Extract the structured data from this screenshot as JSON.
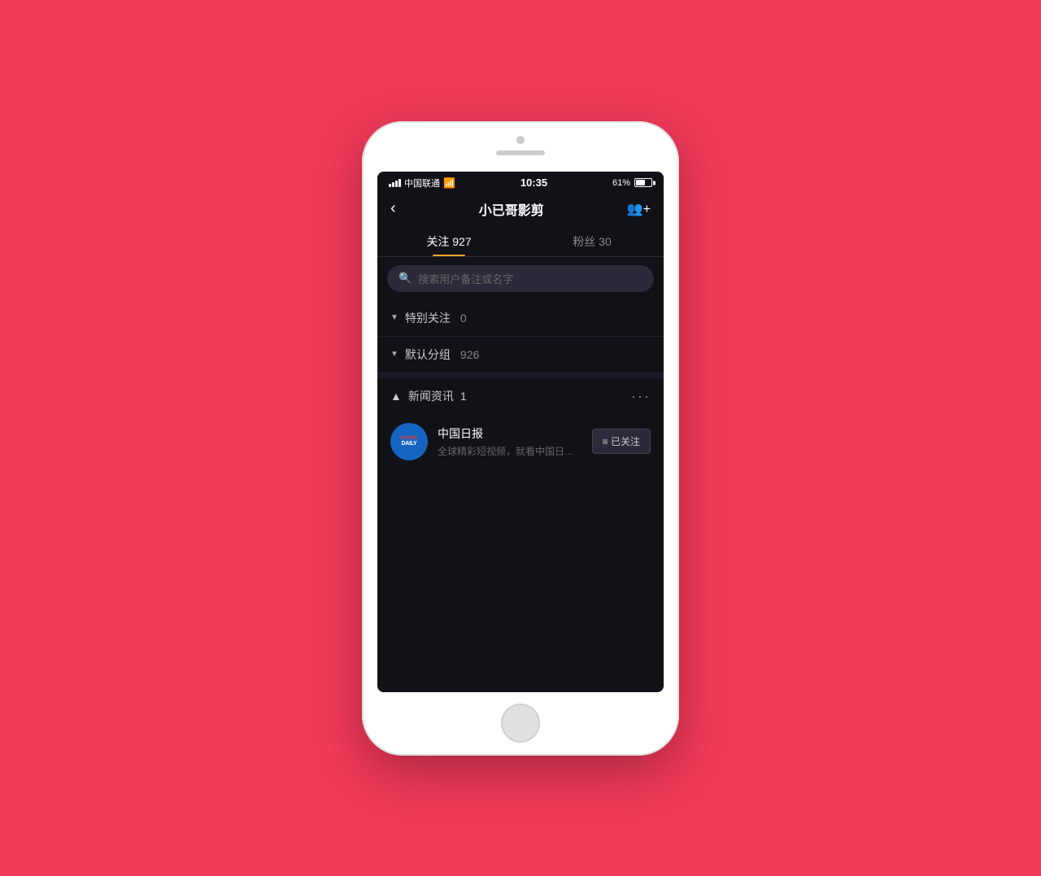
{
  "background": "#f23a5a",
  "statusBar": {
    "carrier": "中国联通",
    "time": "10:35",
    "battery": "61%"
  },
  "navBar": {
    "backIcon": "‹",
    "title": "小已哥影剪",
    "addIcon": "person+"
  },
  "tabs": [
    {
      "label": "关注 927",
      "active": true
    },
    {
      "label": "粉丝 30",
      "active": false
    }
  ],
  "search": {
    "placeholder": "搜索用户备注或名字"
  },
  "groups": [
    {
      "icon": "▼",
      "label": "特别关注",
      "count": "0"
    },
    {
      "icon": "▼",
      "label": "默认分组",
      "count": "926"
    }
  ],
  "newsSection": {
    "icon": "▲",
    "label": "新闻资讯",
    "count": "1",
    "moreIcon": "···"
  },
  "accounts": [
    {
      "name": "中国日报",
      "description": "全球精彩短视频，就看中国日...",
      "logoText1": "CHINA",
      "logoText2": "DAILY",
      "followLabel": "≡ 已关注"
    }
  ]
}
